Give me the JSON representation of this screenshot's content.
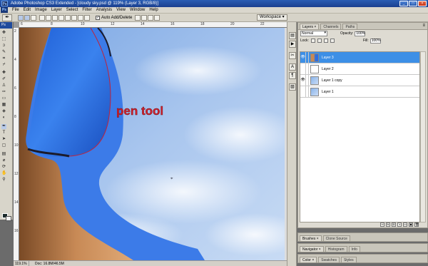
{
  "window": {
    "title": "Adobe Photoshop CS3 Extended - [cloudy sky.psd @ 119% (Layer 3, RGB/8)]",
    "controls": {
      "min": "_",
      "max": "□",
      "close": "×"
    }
  },
  "menubar": {
    "logo": "Ps",
    "items": [
      "File",
      "Edit",
      "Image",
      "Layer",
      "Select",
      "Filter",
      "Analysis",
      "View",
      "Window",
      "Help"
    ]
  },
  "options": {
    "auto_add_delete_label": "Auto Add/Delete",
    "auto_add_delete_checked": true,
    "workspace_label": "Workspace ▾"
  },
  "toolbox": {
    "header": "Ps"
  },
  "document": {
    "canvas_text": "pen tool",
    "ruler_top": [
      "6",
      "8",
      "10",
      "12",
      "14",
      "16",
      "18",
      "20",
      "22"
    ],
    "ruler_left": [
      "2",
      "4",
      "6",
      "8",
      "10",
      "12",
      "14",
      "16"
    ],
    "status_zoom": "119.1%",
    "status_doc": "Doc: 16.8M/46.5M"
  },
  "layers_panel": {
    "tabs": [
      "Layers ×",
      "Channels",
      "Paths"
    ],
    "active_tab": 0,
    "blend_mode": "Normal",
    "opacity_label": "Opacity:",
    "opacity_value": "100%",
    "lock_label": "Lock:",
    "fill_label": "Fill:",
    "fill_value": "100%",
    "layers": [
      {
        "name": "Layer 3",
        "selected": true,
        "visible": true,
        "thumb": "girl"
      },
      {
        "name": "Layer 2",
        "selected": false,
        "visible": false,
        "thumb": "blank"
      },
      {
        "name": "Layer 1 copy",
        "selected": false,
        "visible": true,
        "thumb": "sky"
      },
      {
        "name": "Layer 1",
        "selected": false,
        "visible": false,
        "thumb": "sky"
      }
    ]
  },
  "collapsed_panels": [
    {
      "tabs": [
        "Brushes ×",
        "Clone Source"
      ]
    },
    {
      "tabs": [
        "Navigator ×",
        "Histogram",
        "Info"
      ]
    },
    {
      "tabs": [
        "Color ×",
        "Swatches",
        "Styles"
      ]
    }
  ],
  "colors": {
    "accent_selection": "#3d8fe6",
    "bikini_blue": "#2f6fe8",
    "pen_text_red": "#d0202c"
  }
}
